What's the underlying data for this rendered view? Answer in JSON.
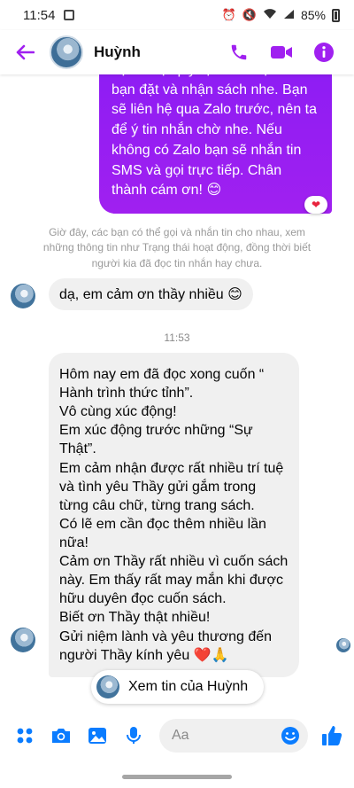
{
  "status_bar": {
    "time": "11:54",
    "battery": "85%"
  },
  "header": {
    "contact_name": "Huỳnh"
  },
  "messages": {
    "outgoing_text": "hệ hỗ trợ quý vị/ anh/ chị/ em/ bạn đặt và nhận sách nhe. Bạn sẽ liên hệ qua Zalo trước, nên ta để ý tin nhắn chờ nhe. Nếu không có Zalo bạn sẽ nhắn tin SMS và gọi trực tiếp. Chân thành cám ơn! 😊",
    "outgoing_reaction": "❤",
    "system_note": "Giờ đây, các bạn có thể gọi và nhắn tin cho nhau, xem những thông tin như Trạng thái hoạt động, đồng thời biết người kia đã đọc tin nhắn hay chưa.",
    "incoming_short": "dạ, em cảm ơn thầy nhiều 😊",
    "timestamp": "11:53",
    "incoming_long": "Hôm nay em đã đọc xong cuốn “ Hành trình thức tỉnh”.\nVô cùng xúc động!\nEm xúc động trước những “Sự Thật”.\nEm cảm nhận được rất nhiều trí tuệ và tình yêu Thầy gửi gắm trong từng câu chữ, từng trang sách.\nCó lẽ em cần đọc thêm nhiều lần nữa!\nCảm ơn Thầy rất nhiều vì cuốn sách này. Em thấy rất may mắn khi được hữu duyên đọc cuốn sách.\nBiết ơn Thầy thật nhiều!\nGửi niệm lành và yêu thương đến người Thầy kính yêu ❤️🙏"
  },
  "view_profile_label": "Xem tin của Huỳnh",
  "composer": {
    "placeholder": "Aa"
  },
  "colors": {
    "accent": "#a020f0",
    "messenger_blue": "#0a7cff"
  },
  "icons": {
    "back": "arrow-left-icon",
    "call": "phone-icon",
    "video": "video-camera-icon",
    "info": "info-icon",
    "apps": "four-dots-icon",
    "camera": "camera-icon",
    "gallery": "image-icon",
    "mic": "microphone-icon",
    "emoji": "smiley-icon",
    "like": "thumbs-up-icon"
  }
}
